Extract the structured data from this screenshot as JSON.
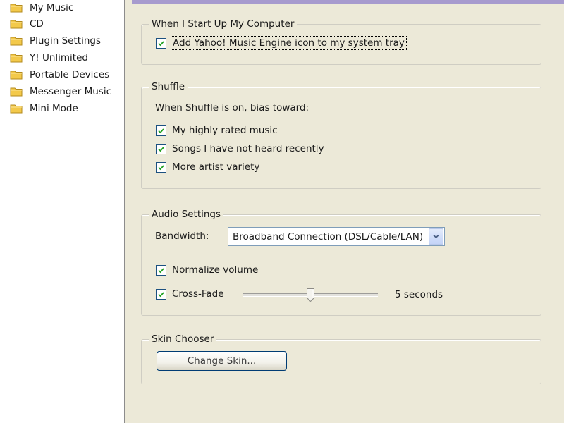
{
  "sidebar": {
    "items": [
      {
        "label": "My Music"
      },
      {
        "label": "CD"
      },
      {
        "label": "Plugin Settings"
      },
      {
        "label": "Y! Unlimited"
      },
      {
        "label": "Portable Devices"
      },
      {
        "label": "Messenger Music"
      },
      {
        "label": "Mini Mode"
      }
    ],
    "folder_icon": "folder-icon",
    "folder_color": "#f3c94b"
  },
  "accent_color": "#a79bce",
  "startup": {
    "title": "When I Start Up My Computer",
    "tray_icon_label": "Add Yahoo! Music Engine icon to my system tray",
    "tray_icon_checked": true
  },
  "shuffle": {
    "title": "Shuffle",
    "description": "When Shuffle is on, bias toward:",
    "options": [
      {
        "label": "My highly rated music",
        "checked": true
      },
      {
        "label": "Songs I have not heard recently",
        "checked": true
      },
      {
        "label": "More artist variety",
        "checked": true
      }
    ]
  },
  "audio": {
    "title": "Audio Settings",
    "bandwidth_label": "Bandwidth:",
    "bandwidth_value": "Broadband Connection (DSL/Cable/LAN)",
    "normalize_label": "Normalize volume",
    "normalize_checked": true,
    "crossfade_label": "Cross-Fade",
    "crossfade_checked": true,
    "crossfade_value_text": "5 seconds",
    "crossfade_slider_fraction": 0.5
  },
  "skin": {
    "title": "Skin Chooser",
    "button_label": "Change Skin..."
  }
}
